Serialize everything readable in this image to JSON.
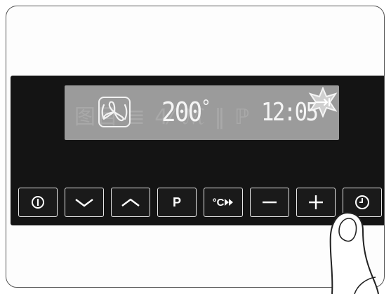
{
  "display": {
    "temperature": "200",
    "degree_symbol": "°",
    "time": "12:05",
    "inactive_segments": "图目 ≣ 4⁄ ℳ ‖ ℙ",
    "icons": {
      "fan": "fan-icon",
      "timer_indicator": "timer-star-icon"
    },
    "colors": {
      "lcd_background": "#9b9b9b",
      "active_segment": "#f5f5f5",
      "inactive_segment": "#ababab"
    }
  },
  "buttons": [
    {
      "name": "power-button",
      "label": "",
      "icon": "power-icon"
    },
    {
      "name": "down-button",
      "label": "",
      "icon": "chevron-down-icon"
    },
    {
      "name": "up-button",
      "label": "",
      "icon": "chevron-up-icon"
    },
    {
      "name": "program-button",
      "label": "P",
      "icon": ""
    },
    {
      "name": "temperature-button",
      "label": "°C",
      "icon": "fast-heat-arrows-icon"
    },
    {
      "name": "minus-button",
      "label": "",
      "icon": "minus-icon"
    },
    {
      "name": "plus-button",
      "label": "",
      "icon": "plus-icon"
    },
    {
      "name": "clock-button",
      "label": "",
      "icon": "clock-icon"
    }
  ],
  "colors": {
    "panel": "#141414",
    "button_border": "#e6e6e6",
    "frame_border": "#555555"
  }
}
